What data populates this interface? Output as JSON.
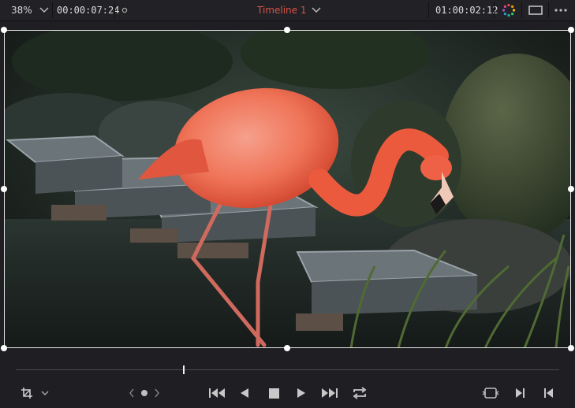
{
  "top_bar": {
    "zoom": "38%",
    "source_timecode": "00:00:07:24",
    "timeline_name": "Timeline 1",
    "record_timecode": "01:00:02:12"
  },
  "icons": {
    "zoom_dropdown": "chevron-down-icon",
    "viewer_options": "circle-dot-icon",
    "timeline_dropdown": "chevron-down-icon",
    "color_wheel": "color-wheel-icon",
    "viewer_layout": "rectangle-icon",
    "more": "ellipsis-icon",
    "transform": "crop-transform-icon",
    "transform_menu": "chevron-down-icon",
    "prev_clip": "chevron-left-icon",
    "clip_dot": "dot-icon",
    "next_clip": "chevron-right-icon",
    "go_to_start": "skip-to-start-icon",
    "play_reverse": "play-reverse-icon",
    "stop": "stop-icon",
    "play": "play-icon",
    "go_to_end": "skip-to-end-icon",
    "loop": "loop-icon",
    "match_frame": "match-frame-icon",
    "mark_in": "mark-in-icon",
    "mark_out": "mark-out-icon"
  },
  "colors": {
    "timeline_name": "#d9534a",
    "background": "#1f1f23",
    "flamingo": "#e8543c"
  },
  "scrubber": {
    "playhead_fraction": 0.31
  }
}
